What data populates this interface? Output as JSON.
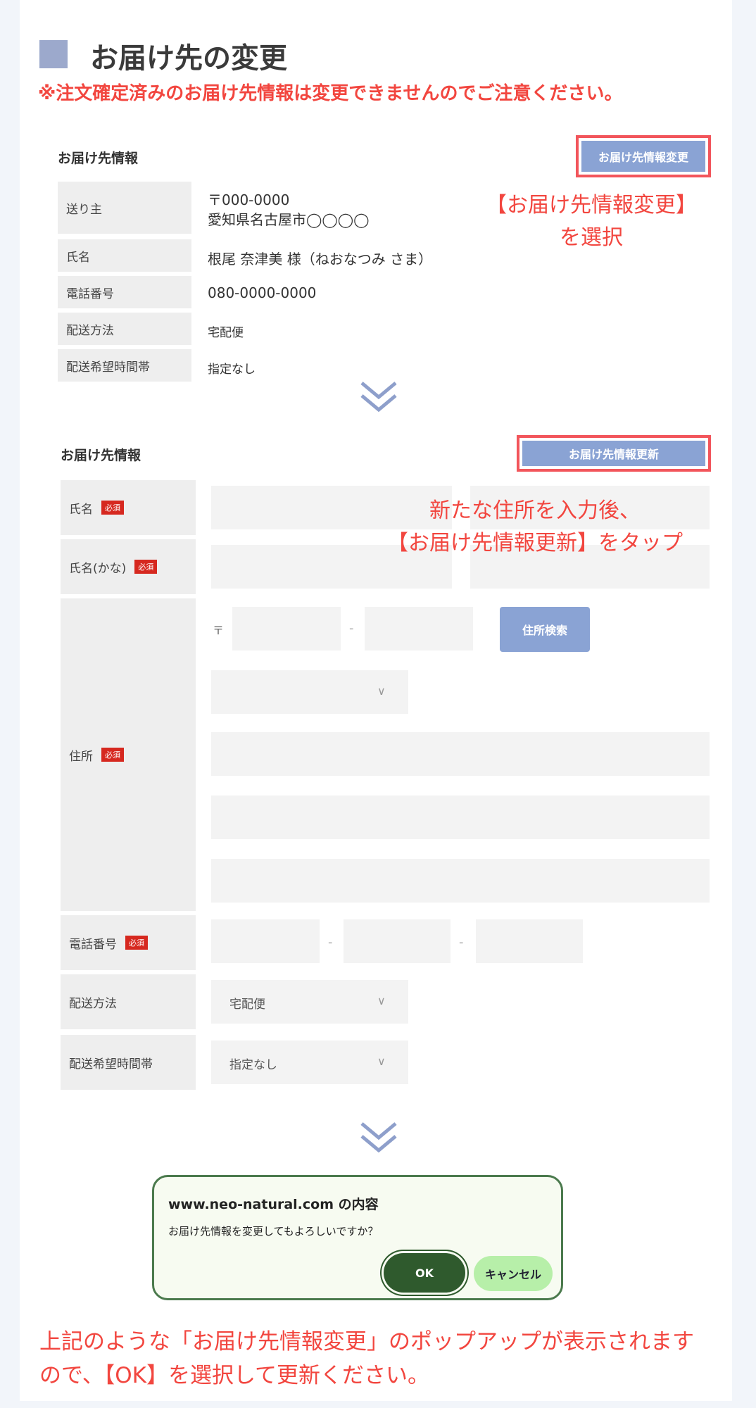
{
  "title": "お届け先の変更",
  "warning": "※注文確定済みのお届け先情報は変更できませんのでご注意ください。",
  "section1": {
    "label": "お届け先情報",
    "button_label": "お届け先情報変更",
    "annotation_line1": "【お届け先情報変更】",
    "annotation_line2": "を選択",
    "rows": [
      {
        "label": "送り主",
        "value_line1": "〒000-0000",
        "value_line2": "愛知県名古屋市◯◯◯◯"
      },
      {
        "label": "氏名",
        "value": "根尾 奈津美 様（ねおなつみ さま）"
      },
      {
        "label": "電話番号",
        "value": "080-0000-0000"
      },
      {
        "label": "配送方法",
        "value": "宅配便"
      },
      {
        "label": "配送希望時間帯",
        "value": "指定なし"
      }
    ]
  },
  "section2": {
    "label": "お届け先情報",
    "button_label": "お届け先情報更新",
    "annotation_line1": "新たな住所を入力後、",
    "annotation_line2": "【お届け先情報更新】をタップ",
    "required_badge": "必須",
    "name_label": "氏名",
    "kana_label": "氏名(かな)",
    "address_label": "住所",
    "postal_mark": "〒",
    "dash": "-",
    "address_search_label": "住所検索",
    "phone_label": "電話番号",
    "delivery_method_label": "配送方法",
    "delivery_method_value": "宅配便",
    "delivery_time_label": "配送希望時間帯",
    "delivery_time_value": "指定なし"
  },
  "dialog": {
    "title": "www.neo-natural.com の内容",
    "message": "お届け先情報を変更してもよろしいですか？",
    "ok_label": "OK",
    "cancel_label": "キャンセル"
  },
  "bottom_note": "上記のような「お届け先情報変更」のポップアップが表示されますので、【OK】を選択して更新ください。",
  "colors": {
    "accent_red": "#f2463f",
    "button_blue": "#8aa3d4",
    "dialog_green": "#2f5a2d",
    "cancel_green": "#b7efa9"
  }
}
